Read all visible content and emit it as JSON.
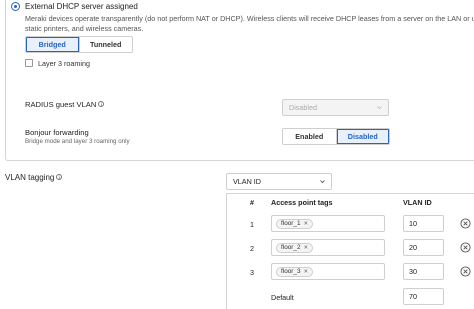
{
  "dhcp": {
    "option_label": "External DHCP server assigned",
    "description": "Meraki devices operate transparently (do not perform NAT or DHCP). Wireless clients will receive DHCP leases from a server on the LAN or use static printers, and wireless cameras.",
    "mode_options": [
      "Bridged",
      "Tunneled"
    ],
    "mode_selected": "Bridged",
    "layer3_roaming_label": "Layer 3 roaming"
  },
  "radius_guest_vlan": {
    "label": "RADIUS guest VLAN",
    "value": "Disabled"
  },
  "bonjour": {
    "label": "Bonjour forwarding",
    "sublabel": "Bridge mode and layer 3 roaming only",
    "options": [
      "Enabled",
      "Disabled"
    ],
    "selected": "Disabled"
  },
  "vlan_tagging": {
    "label": "VLAN tagging",
    "value": "VLAN ID"
  },
  "vlan_table": {
    "headers": [
      "#",
      "Access point tags",
      "VLAN ID"
    ],
    "rows": [
      {
        "num": "1",
        "tag": "floor_1",
        "vlan": "10"
      },
      {
        "num": "2",
        "tag": "floor_2",
        "vlan": "20"
      },
      {
        "num": "3",
        "tag": "floor_3",
        "vlan": "30"
      }
    ],
    "default_label": "Default",
    "default_vlan": "70"
  },
  "icons": {
    "info": "info-icon",
    "chevron": "chevron-down-icon",
    "remove": "remove-circle-icon",
    "chip_remove": "close-icon"
  },
  "colors": {
    "accent": "#2563c9",
    "active_bg": "#e8f0fc",
    "border": "#cfcfcf"
  }
}
